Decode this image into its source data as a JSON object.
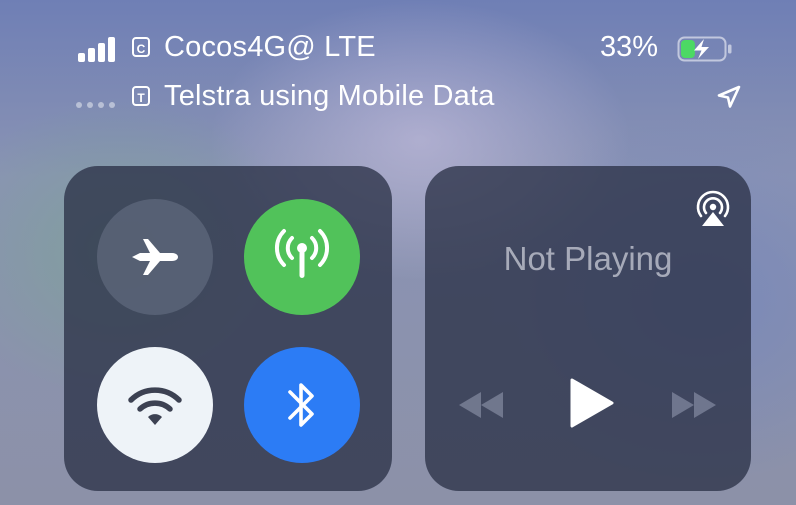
{
  "status_bar": {
    "primary": {
      "sim_badge": "C",
      "carrier": "Cocos4G@ LTE",
      "signal_bars_filled": 4,
      "signal_bars_total": 4
    },
    "secondary": {
      "sim_badge": "T",
      "carrier": "Telstra using Mobile Data",
      "signal_dots": 4
    },
    "battery": {
      "percent_label": "33%",
      "level": 0.33,
      "charging": true,
      "fill_color": "#4cd964"
    },
    "location_icon": "location-arrow-icon"
  },
  "connectivity": {
    "airplane": {
      "icon": "airplane-icon",
      "active": false
    },
    "cellular": {
      "icon": "cellular-antenna-icon",
      "active": true,
      "color": "#51c25a"
    },
    "wifi": {
      "icon": "wifi-icon",
      "active": true,
      "color": "#eef3f8"
    },
    "bluetooth": {
      "icon": "bluetooth-icon",
      "active": true,
      "color": "#2c7cf5"
    }
  },
  "media": {
    "status": "Not Playing",
    "airplay_icon": "airplay-audio-icon",
    "controls": [
      "rewind-icon",
      "play-icon",
      "fast-forward-icon"
    ]
  }
}
